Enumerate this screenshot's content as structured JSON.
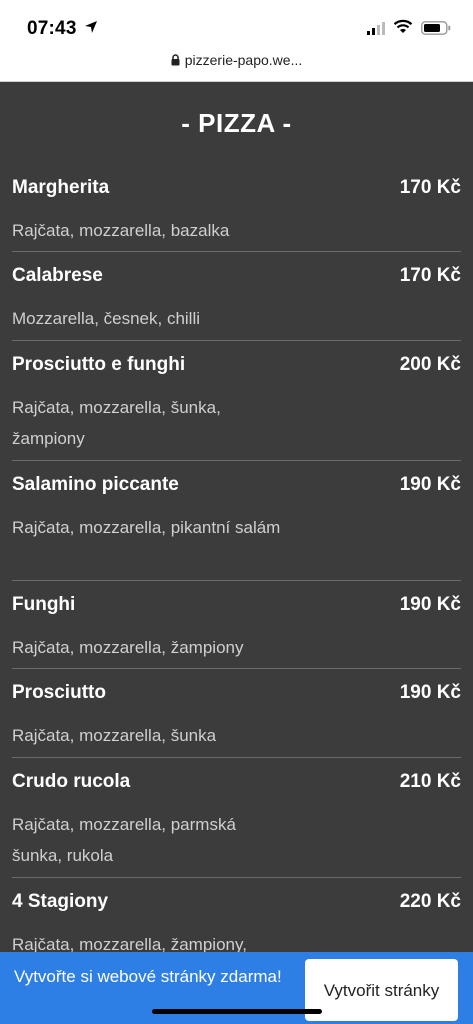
{
  "status_bar": {
    "time": "07:43"
  },
  "url_bar": {
    "url": "pizzerie-papo.we..."
  },
  "menu": {
    "heading": "- PIZZA -",
    "items": [
      {
        "name": "Margherita",
        "price": "170 Kč",
        "desc": "Rajčata, mozzarella, bazalka"
      },
      {
        "name": "Calabrese",
        "price": "170 Kč",
        "desc": "Mozzarella, česnek, chilli"
      },
      {
        "name": "Prosciutto e funghi",
        "price": "200 Kč",
        "desc": "Rajčata, mozzarella, šunka, žampiony"
      },
      {
        "name": "Salamino piccante",
        "price": "190 Kč",
        "desc": "Rajčata, mozzarella, pikantní salám"
      },
      {
        "name": "Funghi",
        "price": "190 Kč",
        "desc": "Rajčata, mozzarella, žampiony"
      },
      {
        "name": "Prosciutto",
        "price": "190 Kč",
        "desc": "Rajčata, mozzarella, šunka"
      },
      {
        "name": "Crudo rucola",
        "price": "210 Kč",
        "desc": "Rajčata, mozzarella, parmská šunka, rukola"
      },
      {
        "name": "4 Stagiony",
        "price": "220 Kč",
        "desc": "Rajčata, mozzarella, žampiony,"
      }
    ]
  },
  "banner": {
    "text": "Vytvořte si webové stránky zdarma!",
    "button_label": "Vytvořit stránky"
  }
}
